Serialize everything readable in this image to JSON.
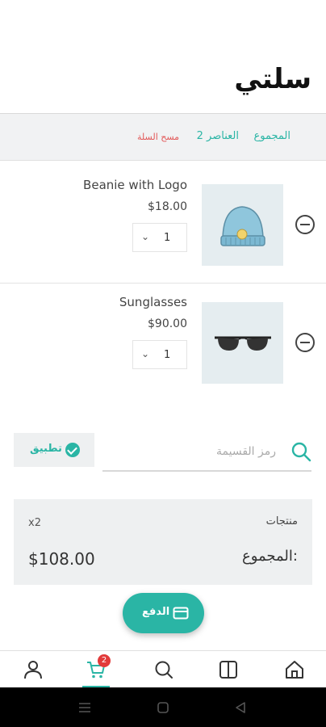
{
  "header": {
    "title": "سلتي"
  },
  "summary": {
    "total_label": "المجموع",
    "items_count": "2 العناصر",
    "clear_cart": "مسح السلة"
  },
  "items": [
    {
      "name": "Beanie with Logo",
      "price": "$18.00",
      "quantity": "1",
      "image": "beanie-image"
    },
    {
      "name": "Sunglasses",
      "price": "$90.00",
      "quantity": "1",
      "image": "sunglasses-image"
    }
  ],
  "coupon": {
    "placeholder": "رمز القسيمة",
    "apply_label": "تطبيق"
  },
  "totals": {
    "products_label": "منتجات",
    "products_count": "x2",
    "sum_label": "المجموع:",
    "sum_value": "$108.00"
  },
  "checkout": {
    "label": "الدفع",
    "icon": "credit-card-icon"
  },
  "bottom_nav": {
    "items": [
      "home-icon",
      "categories-icon",
      "search-icon",
      "cart-icon",
      "account-icon"
    ],
    "cart_badge": "2",
    "active": "cart"
  },
  "colors": {
    "accent": "#2ab5a5",
    "danger": "#e25858",
    "badge": "#e23a3a"
  }
}
